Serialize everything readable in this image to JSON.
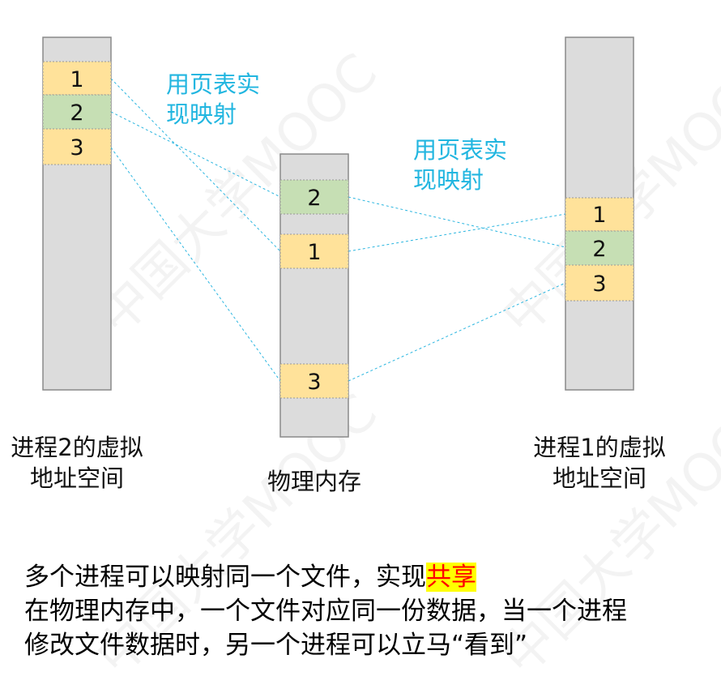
{
  "watermark": "中国大学MOOC",
  "process2": {
    "label_line1": "进程2的虚拟",
    "label_line2": "地址空间",
    "pages": [
      "1",
      "2",
      "3"
    ]
  },
  "physical_memory": {
    "label": "物理内存",
    "pages": [
      "2",
      "1",
      "3"
    ]
  },
  "process1": {
    "label_line1": "进程1的虚拟",
    "label_line2": "地址空间",
    "pages": [
      "1",
      "2",
      "3"
    ]
  },
  "mapping_label_left": {
    "line1": "用页表实",
    "line2": "现映射"
  },
  "mapping_label_right": {
    "line1": "用页表实",
    "line2": "现映射"
  },
  "bottom": {
    "line1_prefix": "多个进程可以映射同一个文件，实现",
    "line1_highlight": "共享",
    "line2": "在物理内存中，一个文件对应同一份数据，当一个进程",
    "line3": "修改文件数据时，另一个进程可以立马“看到”"
  },
  "colors": {
    "column_fill": "#dcdcdc",
    "column_stroke": "#8a8a8a",
    "page_yellow": "#ffe29a",
    "page_green": "#c6dfb4",
    "mapping_line": "#2cb6e0",
    "label_blue": "#22b6e0",
    "highlight_bg": "#ffff00",
    "highlight_text": "#ff0000"
  }
}
